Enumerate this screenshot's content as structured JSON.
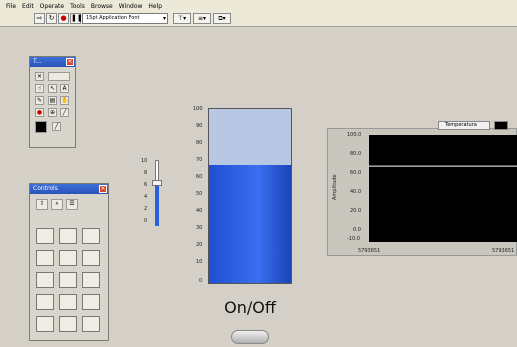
{
  "menu": [
    "File",
    "Edit",
    "Operate",
    "Tools",
    "Browse",
    "Window",
    "Help"
  ],
  "toolbar": {
    "font": "15pt Application Font"
  },
  "tools_palette": {
    "title": "T..."
  },
  "controls_palette": {
    "title": "Controls"
  },
  "slider": {
    "ticks": [
      "10",
      "8",
      "6",
      "4",
      "2",
      "0"
    ],
    "value": 6.5
  },
  "tank": {
    "ticks": [
      "100",
      "90",
      "80",
      "70",
      "60",
      "50",
      "40",
      "30",
      "20",
      "10",
      "0"
    ],
    "level": 68
  },
  "switch_label": "On/Off",
  "chart_data": {
    "type": "line",
    "legend": [
      "Temperatura"
    ],
    "ylabel": "Amplitude",
    "yticks": [
      "100.0",
      "80.0",
      "60.0",
      "40.0",
      "20.0",
      "0.0",
      "-10.0"
    ],
    "ylim": [
      -10,
      100
    ],
    "xticks": [
      "5793651",
      "5793651"
    ],
    "series": [
      {
        "name": "Temperatura",
        "values": [
          68,
          68
        ]
      }
    ]
  }
}
